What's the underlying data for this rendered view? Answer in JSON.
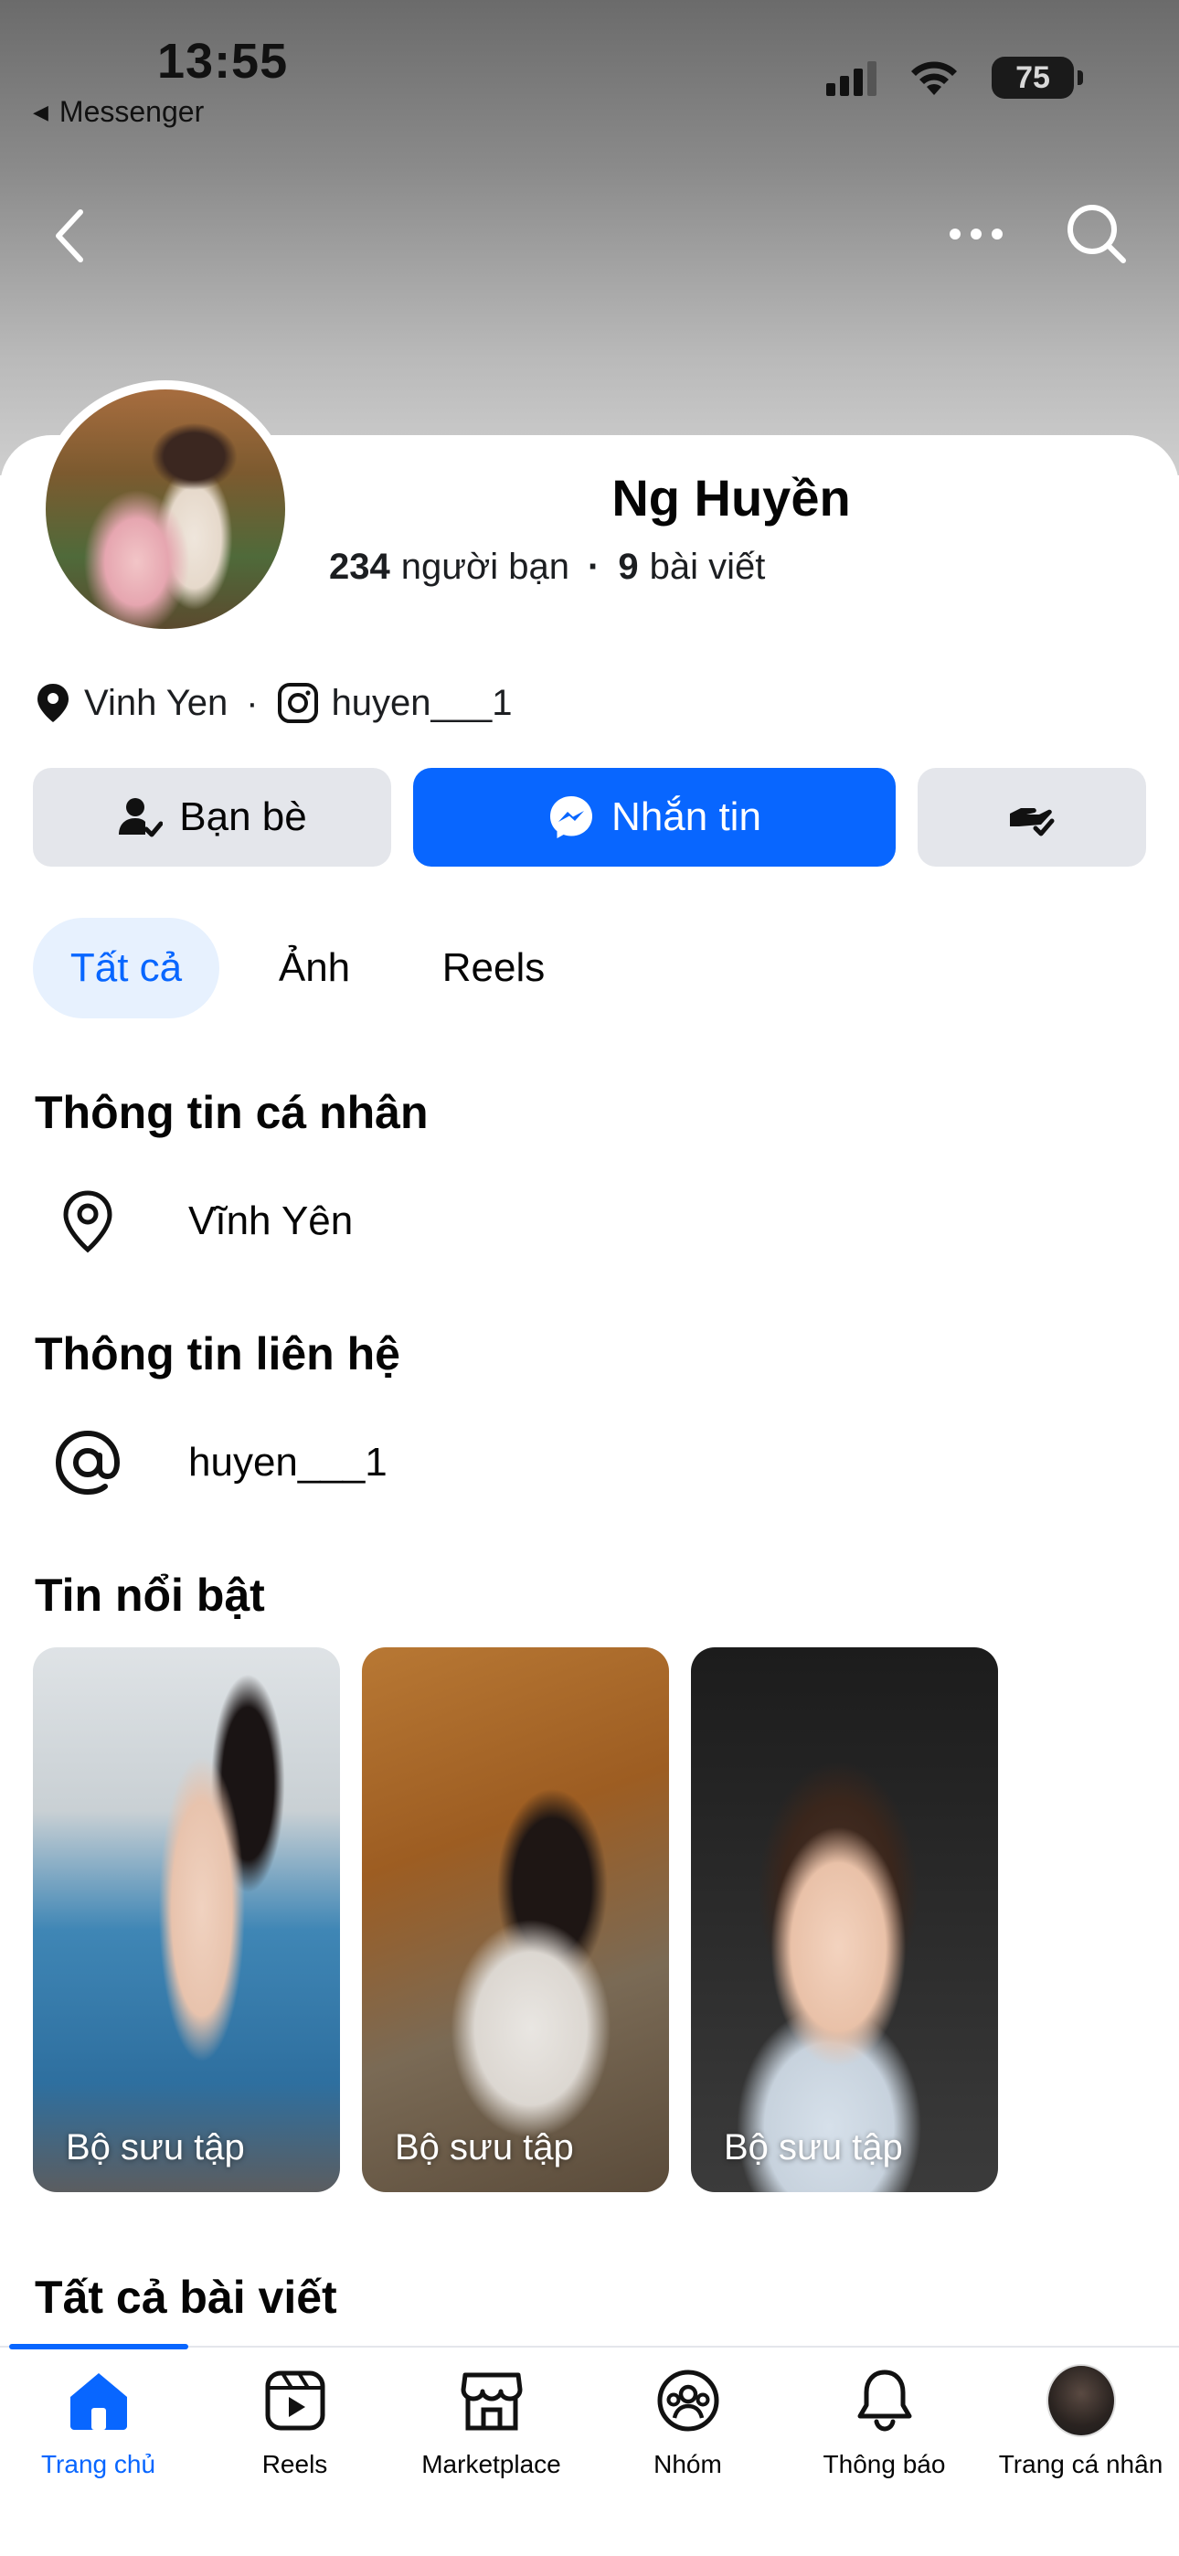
{
  "status_bar": {
    "time": "13:55",
    "back_app": "Messenger",
    "battery": "75"
  },
  "profile": {
    "name": "Ng Huyền",
    "friends_count": "234",
    "friends_label": "người bạn",
    "posts_count": "9",
    "posts_label": "bài viết",
    "location_short": "Vinh Yen",
    "instagram": "huyen___1"
  },
  "actions": {
    "friends_button": "Bạn bè",
    "message_button": "Nhắn tin"
  },
  "tabs": [
    {
      "label": "Tất cả",
      "active": true
    },
    {
      "label": "Ảnh",
      "active": false
    },
    {
      "label": "Reels",
      "active": false
    }
  ],
  "personal_info": {
    "title": "Thông tin cá nhân",
    "location": "Vĩnh Yên"
  },
  "contact_info": {
    "title": "Thông tin liên hệ",
    "handle": "huyen___1"
  },
  "highlights": {
    "title": "Tin nổi bật",
    "items": [
      {
        "label": "Bộ sưu tập"
      },
      {
        "label": "Bộ sưu tập"
      },
      {
        "label": "Bộ sưu tập"
      }
    ]
  },
  "all_posts": {
    "title": "Tất cả bài viết"
  },
  "tabbar": {
    "items": [
      {
        "label": "Trang chủ",
        "icon": "home-icon",
        "active": true
      },
      {
        "label": "Reels",
        "icon": "reels-icon",
        "active": false
      },
      {
        "label": "Marketplace",
        "icon": "marketplace-icon",
        "active": false
      },
      {
        "label": "Nhóm",
        "icon": "groups-icon",
        "active": false
      },
      {
        "label": "Thông báo",
        "icon": "bell-icon",
        "active": false
      },
      {
        "label": "Trang cá nhân",
        "icon": "profile-avatar",
        "active": false
      }
    ]
  },
  "colors": {
    "accent": "#0866ff",
    "button_gray": "#e4e6eb",
    "tab_active_bg": "#e7f1fe"
  }
}
